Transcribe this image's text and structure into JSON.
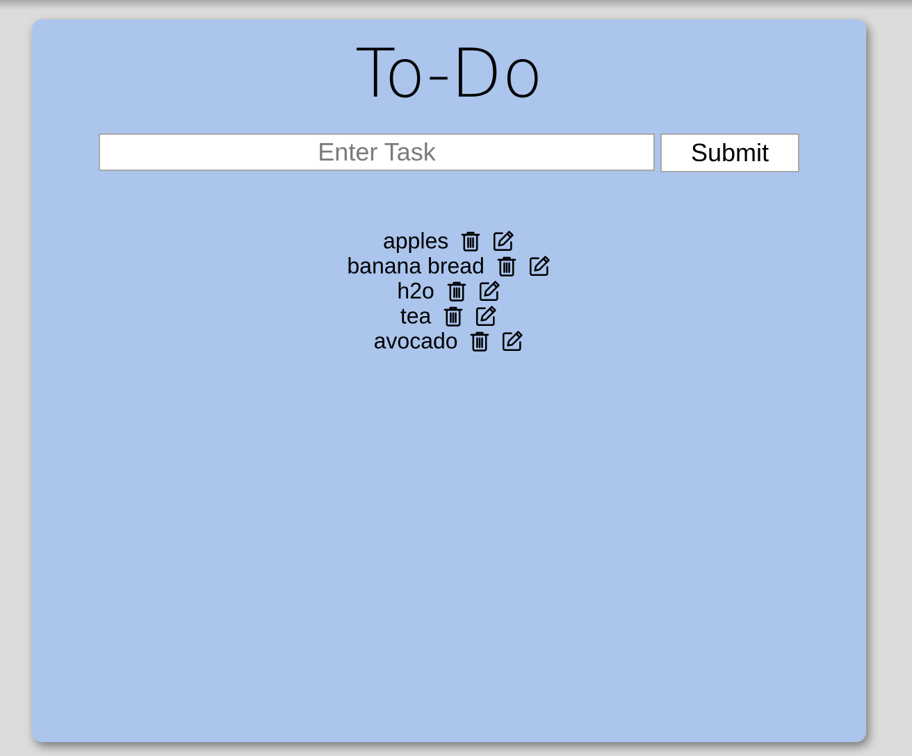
{
  "app": {
    "title": "To-Do"
  },
  "form": {
    "input_placeholder": "Enter Task",
    "input_value": "",
    "submit_label": "Submit"
  },
  "tasks": [
    {
      "text": "apples",
      "delete_icon": "trash-icon",
      "edit_icon": "edit-icon"
    },
    {
      "text": "banana bread",
      "delete_icon": "trash-icon",
      "edit_icon": "edit-icon"
    },
    {
      "text": "h2o",
      "delete_icon": "trash-icon",
      "edit_icon": "edit-icon"
    },
    {
      "text": "tea",
      "delete_icon": "trash-icon",
      "edit_icon": "edit-icon"
    },
    {
      "text": "avocado",
      "delete_icon": "trash-icon",
      "edit_icon": "edit-icon"
    }
  ],
  "colors": {
    "card_background": "#abc5ed",
    "page_background": "#dcdcdc",
    "text": "#000000"
  }
}
